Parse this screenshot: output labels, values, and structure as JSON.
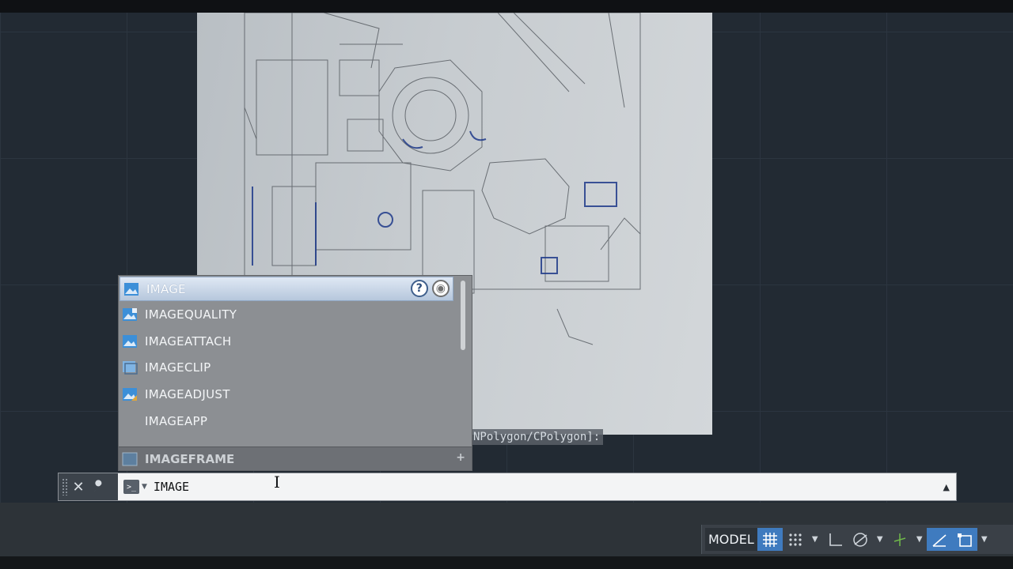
{
  "drawing": {
    "prompt_text": "NPolygon/CPolygon]:"
  },
  "autocomplete": {
    "items": [
      {
        "label": "IMAGE",
        "icon": "image-icon",
        "selected": true
      },
      {
        "label": "IMAGEQUALITY",
        "icon": "image-quality-icon"
      },
      {
        "label": "IMAGEATTACH",
        "icon": "image-attach-icon"
      },
      {
        "label": "IMAGECLIP",
        "icon": "image-clip-icon"
      },
      {
        "label": "IMAGEADJUST",
        "icon": "image-adjust-icon"
      },
      {
        "label": "IMAGEAPP",
        "icon": ""
      }
    ],
    "help_icon": "help-icon",
    "web_icon": "globe-icon",
    "footer_item": {
      "label": "IMAGEFRAME",
      "icon": "image-frame-icon"
    }
  },
  "command_line": {
    "value": "IMAGE",
    "close_icon": "close-icon",
    "customize_icon": "wrench-icon",
    "prompt_icon": "command-prompt-icon",
    "expand_icon": "triangle-up-icon"
  },
  "status_bar": {
    "model_label": "MODEL",
    "buttons": [
      {
        "name": "grid-display-icon",
        "active": true
      },
      {
        "name": "snap-mode-icon",
        "active": false
      },
      {
        "name": "ortho-mode-icon",
        "active": false
      },
      {
        "name": "polar-tracking-icon",
        "active": false
      },
      {
        "name": "object-snap-tracking-icon",
        "active": false
      },
      {
        "name": "dynamic-ucs-icon",
        "active": true
      },
      {
        "name": "selection-cycling-icon",
        "active": true
      }
    ]
  },
  "colors": {
    "canvas": "#222a33",
    "selection": "#b6c7dc",
    "accent": "#3f7bbf"
  }
}
